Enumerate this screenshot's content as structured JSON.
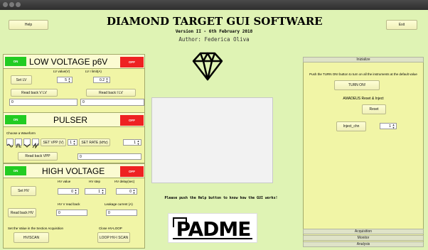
{
  "header": {
    "help": "Help",
    "exit": "Exit",
    "title": "DIAMOND TARGET GUI SOFTWARE",
    "version": "Version II - 6th February 2018",
    "author": "Author: Federica Oliva"
  },
  "lv": {
    "on": "ON",
    "off": "OFF",
    "title": "LOW VOLTAGE p6V",
    "value_label": "LV value(V)",
    "limit_label": "LV I limit(A)",
    "set_label": "Set LV",
    "value": "5",
    "limit": "0.2",
    "read_v": "Read back V LV",
    "read_i": "Read back I LV",
    "read_v_val": "0",
    "read_i_val": "0"
  },
  "pulser": {
    "on": "ON",
    "off": "OFF",
    "title": "PULSER",
    "waveform_label": "Choose a Waveform",
    "set_vpp": "SET VPP (V)",
    "vpp": "1",
    "set_rate": "SET RATE (kHz)",
    "rate": "1",
    "read_vpp": "Read back VPP",
    "read_vpp_val": "0"
  },
  "hv": {
    "on": "ON",
    "off": "OFF",
    "title": "HIGH VOLTAGE",
    "value_label": "HV value",
    "step_label": "HV step",
    "delay_label": "HV delay(sec)",
    "set_label": "Set HV",
    "value": "0",
    "step": "1",
    "delay": "0",
    "v_read_label": "HV V read back",
    "leak_label": "Leakage current (A)",
    "read_label": "Read back HV",
    "v_read_val": "0",
    "leak_val": "0",
    "scan_desc": "Set the Value in the Section Acquisition",
    "scan_btn": "HV/SCAN",
    "loop_desc": "Close HV-LOOP",
    "loop_btn": "LOOP HV-I SCAN"
  },
  "center": {
    "help_text": "Please push the Help button to know how the GUI works!",
    "logo": "PADME"
  },
  "right": {
    "init_tab": "Inizialize",
    "info": "Push the TURN ON! button to turn on all the instruments at the default value",
    "turn_on": "TURN ON!",
    "amadeus": "AMADEUS Reset & Inject",
    "reset": "Reset",
    "inject": "Inject_chn",
    "inject_val": "1",
    "tab_acq": "Acquisition",
    "tab_mon": "Monitor",
    "tab_ana": "Analysis"
  }
}
